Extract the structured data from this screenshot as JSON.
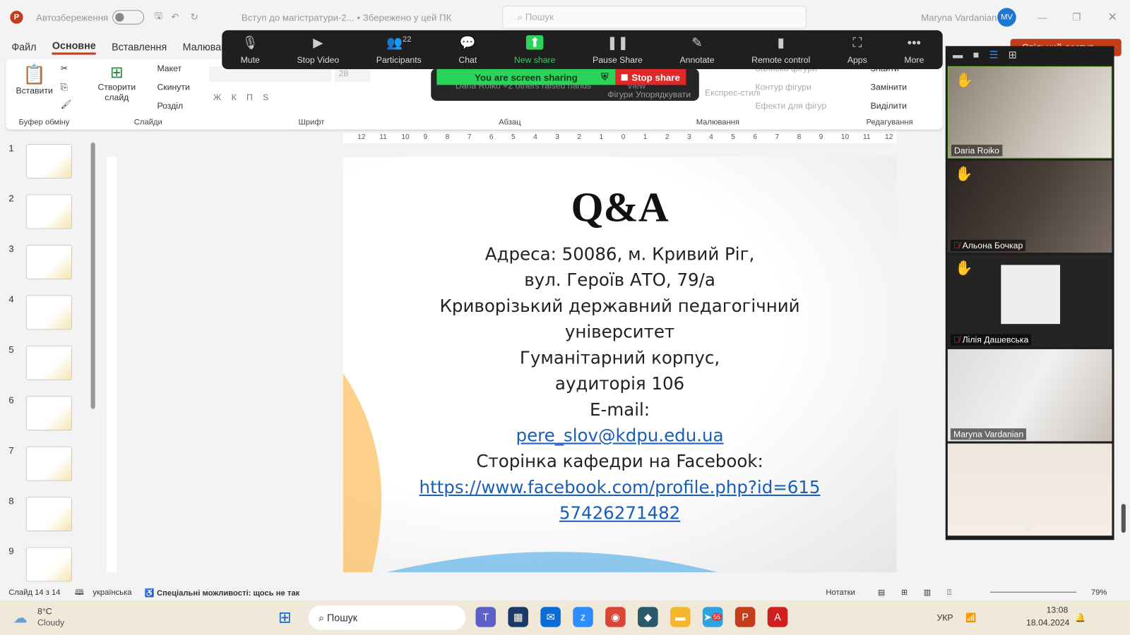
{
  "titlebar": {
    "autosave": "Автозбереження",
    "doc_title": "Вступ до магістратури-2... • Збережено у цей ПК",
    "search_placeholder": "Пошук",
    "user": "Maryna Vardanian",
    "avatar": "MV"
  },
  "menu": [
    "Файл",
    "Основне",
    "Вставлення",
    "Малювання"
  ],
  "ribbon": {
    "paste": "Вставити",
    "new_slide": "Створити слайд",
    "layout": "Макет",
    "reset": "Скинути",
    "section": "Розділ",
    "font_size": "28",
    "group_clipboard": "Буфер обміну",
    "group_slides": "Слайди",
    "group_font": "Шрифт",
    "group_paragraph": "Абзац",
    "group_drawing": "Малювання",
    "group_editing": "Редагування",
    "shapes": "Фігури",
    "arrange": "Упорядкувати",
    "styles": "Експрес-стилі",
    "fill": "Заливка фігури",
    "outline": "Контур фігури",
    "effects": "Ефекти для фігур",
    "find": "Знайти",
    "replace": "Замінити",
    "select": "Виділити",
    "share_btn": "Спільний доступ"
  },
  "zoom_toolbar": [
    {
      "label": "Mute",
      "icon": "microphone-icon"
    },
    {
      "label": "Stop Video",
      "icon": "camera-icon"
    },
    {
      "label": "Participants",
      "icon": "participants-icon",
      "count": "22"
    },
    {
      "label": "Chat",
      "icon": "chat-icon"
    },
    {
      "label": "New share",
      "icon": "share-arrow-icon"
    },
    {
      "label": "Pause Share",
      "icon": "pause-icon"
    },
    {
      "label": "Annotate",
      "icon": "pencil-icon"
    },
    {
      "label": "Remote control",
      "icon": "mouse-icon"
    },
    {
      "label": "Apps",
      "icon": "apps-icon"
    },
    {
      "label": "More",
      "icon": "more-icon"
    }
  ],
  "sharing": {
    "status": "You are screen sharing",
    "stop": "Stop share",
    "raised": "Daria Roiko +2 others raised hands",
    "view": "View"
  },
  "slides": [
    "1",
    "2",
    "3",
    "4",
    "5",
    "6",
    "7",
    "8",
    "9"
  ],
  "ruler": [
    "12",
    "11",
    "10",
    "9",
    "8",
    "7",
    "6",
    "5",
    "4",
    "3",
    "2",
    "1",
    "0",
    "1",
    "2",
    "3",
    "4",
    "5",
    "6",
    "7",
    "8",
    "9",
    "10",
    "11",
    "12"
  ],
  "slide": {
    "title": "Q&A",
    "lines": [
      "Адреса: 50086, м. Кривий Ріг,",
      "вул. Героїв АТО, 79/а",
      "Криворізький державний педагогічний",
      "університет",
      "Гуманітарний корпус,",
      "аудиторія 106",
      "E-mail:"
    ],
    "email": "pere_slov@kdpu.edu.ua",
    "fb_label": "Сторінка кафедри на Facebook:",
    "fb_link1": "https://www.facebook.com/profile.php?id=615",
    "fb_link2": "57426271482"
  },
  "participants": [
    {
      "name": "Daria Roiko",
      "hand": true,
      "muted": false
    },
    {
      "name": "Альона Бочкар",
      "hand": true,
      "muted": true
    },
    {
      "name": "Лілія Дашевська",
      "hand": true,
      "muted": true
    },
    {
      "name": "Maryna Vardanian",
      "hand": false,
      "muted": false
    },
    {
      "name": "",
      "hand": false,
      "muted": false
    }
  ],
  "statusbar": {
    "slide": "Слайд 14 з 14",
    "lang": "українська",
    "access": "Спеціальні можливості: щось не так",
    "notes": "Нотатки",
    "zoom": "79%"
  },
  "taskbar": {
    "temp": "8°C",
    "weather": "Cloudy",
    "search": "Пошук",
    "lang": "УКР",
    "time": "13:08",
    "date": "18.04.2024",
    "telegram_badge": "55"
  },
  "colors": {
    "accent": "#c43e1c",
    "zoom_green": "#2cd35a",
    "stop_red": "#e02828",
    "link": "#1a5fb4"
  }
}
